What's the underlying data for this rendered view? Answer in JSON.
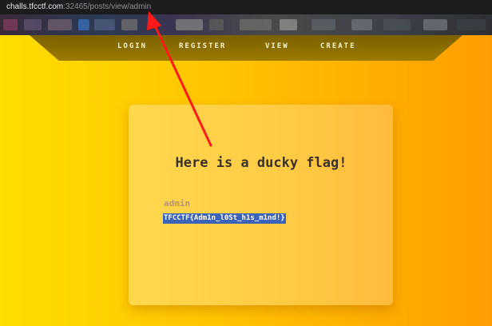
{
  "browser": {
    "url_host": "challs.tfcctf.com",
    "url_path": ":32465/posts/view/admin"
  },
  "nav": {
    "items": [
      "LOGIN",
      "REGISTER",
      "VIEW",
      "CREATE"
    ]
  },
  "post": {
    "title": "Here is a ducky flag!",
    "author": "admin",
    "content": "TFCCTF{Adm1n_l0St_h1s_m1nd!}"
  },
  "annotation": {
    "arrow_color": "#ff1a1a"
  },
  "colors": {
    "background_start": "#ffdd00",
    "background_end": "#ff9d00",
    "selection": "#3c63b8"
  }
}
